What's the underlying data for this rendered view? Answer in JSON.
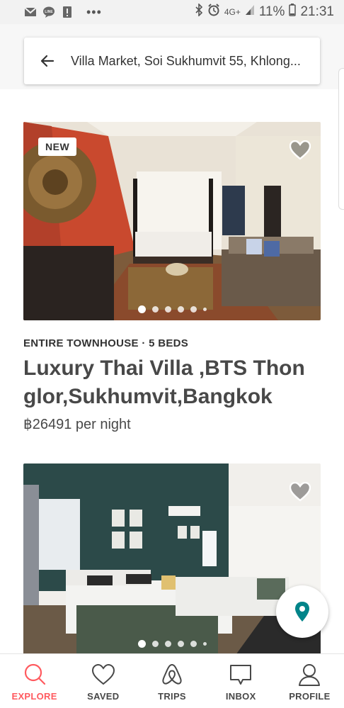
{
  "status_bar": {
    "network": "4G+",
    "battery": "11%",
    "time": "21:31",
    "left_icons": [
      "gmail-icon",
      "line-icon",
      "alert-icon",
      "more-dots-icon"
    ],
    "right_icons": [
      "bluetooth-icon",
      "alarm-icon",
      "signal-icon",
      "battery-icon"
    ]
  },
  "search": {
    "location": "Villa Market, Soi Sukhumvit 55, Khlong..."
  },
  "listings": [
    {
      "badge": "NEW",
      "room_type": "ENTIRE TOWNHOUSE · 5 BEDS",
      "title": "Luxury Thai Villa ,BTS Thon glor,Sukhumvit,Bangkok",
      "price": "฿26491 per night",
      "photo_index": 1,
      "photo_count_indicator": 6
    },
    {
      "photo_index": 1,
      "photo_count_indicator": 6
    }
  ],
  "bottom_nav": {
    "items": [
      {
        "label": "EXPLORE",
        "icon": "search-icon",
        "active": true
      },
      {
        "label": "SAVED",
        "icon": "heart-icon",
        "active": false
      },
      {
        "label": "TRIPS",
        "icon": "airbnb-logo-icon",
        "active": false
      },
      {
        "label": "INBOX",
        "icon": "message-icon",
        "active": false
      },
      {
        "label": "PROFILE",
        "icon": "user-icon",
        "active": false
      }
    ]
  },
  "colors": {
    "accent": "#ff5a5f",
    "map_pin": "#008489",
    "text": "#484848"
  }
}
